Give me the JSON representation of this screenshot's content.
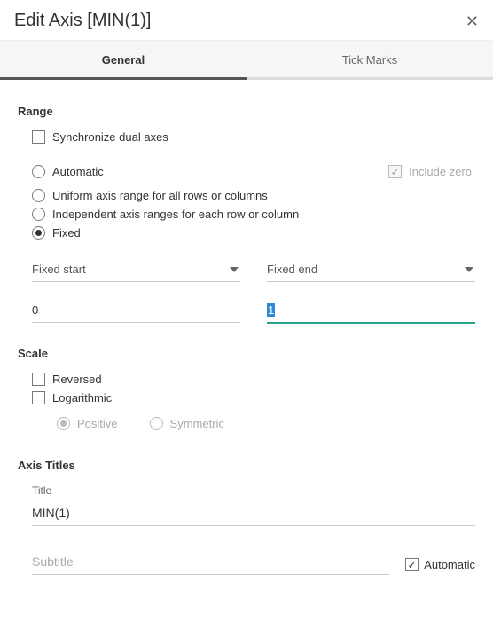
{
  "header": {
    "title": "Edit Axis [MIN(1)]"
  },
  "tabs": {
    "general": "General",
    "tick_marks": "Tick Marks"
  },
  "range": {
    "title": "Range",
    "sync": "Synchronize dual axes",
    "automatic": "Automatic",
    "include_zero": "Include zero",
    "uniform": "Uniform axis range for all rows or columns",
    "independent": "Independent axis ranges for each row or column",
    "fixed": "Fixed",
    "fixed_start_label": "Fixed start",
    "fixed_end_label": "Fixed end",
    "fixed_start_value": "0",
    "fixed_end_value": "1"
  },
  "scale": {
    "title": "Scale",
    "reversed": "Reversed",
    "logarithmic": "Logarithmic",
    "positive": "Positive",
    "symmetric": "Symmetric"
  },
  "axis_titles": {
    "title": "Axis Titles",
    "title_label": "Title",
    "title_value": "MIN(1)",
    "subtitle_placeholder": "Subtitle",
    "automatic": "Automatic"
  }
}
